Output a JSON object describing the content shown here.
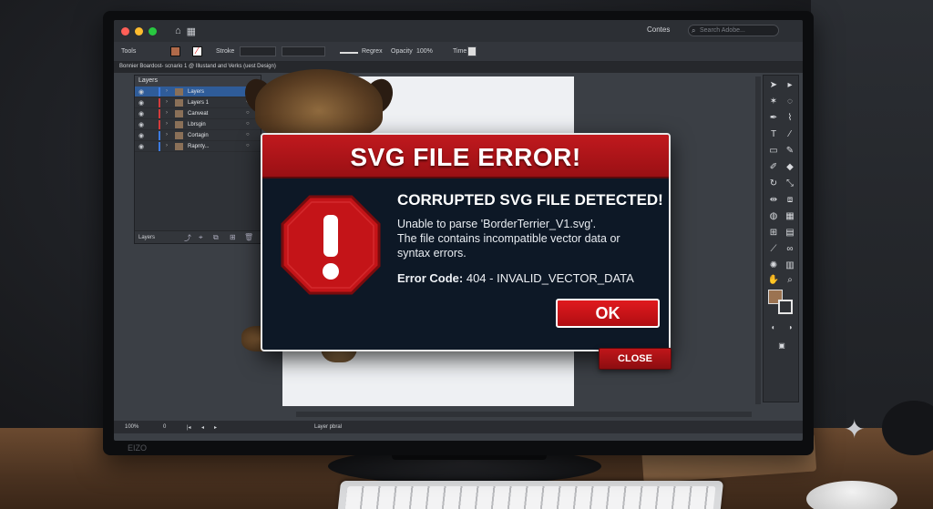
{
  "app": {
    "workspace_label": "Contes",
    "search_placeholder": "Search Adobe...",
    "document_tab": "Bonnier Boardost- scnario 1 @ Illustand and Verks (uest Design)"
  },
  "control_bar": {
    "tools_label": "Tools",
    "stroke_label": "Stroke",
    "brush_label": "Regrex",
    "opacity_label": "Opacity",
    "opacity_value": "100%",
    "style_label": "Time"
  },
  "layers_panel": {
    "title": "Layers",
    "footer_label": "Layers",
    "rows": [
      {
        "name": "Layers",
        "color": "#3d7be0",
        "selected": true
      },
      {
        "name": "Layers 1",
        "color": "#d43b3b",
        "selected": false
      },
      {
        "name": "Canveat",
        "color": "#d43b3b",
        "selected": false
      },
      {
        "name": "Lbrsgin",
        "color": "#d43b3b",
        "selected": false
      },
      {
        "name": "Cortagin",
        "color": "#3d7be0",
        "selected": false
      },
      {
        "name": "Rapnty...",
        "color": "#3d7be0",
        "selected": false
      }
    ]
  },
  "status_bar": {
    "zoom": "100%",
    "page": "0",
    "layer_label": "Layer pbral",
    "brand": "EIZO"
  },
  "dialog": {
    "title": "SVG FILE ERROR!",
    "heading": "CORRUPTED SVG FILE DETECTED!",
    "message_lines": [
      "Unable to parse 'BorderTerrier_V1.svg'.",
      "The file contains incompatible vector data or",
      "syntax errors."
    ],
    "error_code_label": "Error Code: ",
    "error_code_value": "404 - INVALID_VECTOR_DATA",
    "ok_label": "OK",
    "close_label": "CLOSE",
    "accent_color": "#c0191e"
  },
  "icons": {
    "warning": "stop-warning-icon",
    "home": "home-icon",
    "search": "search-icon"
  }
}
